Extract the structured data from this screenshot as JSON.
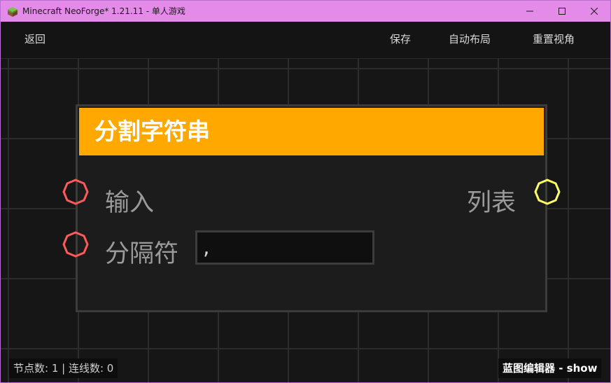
{
  "window": {
    "title": "Minecraft NeoForge* 1.21.11 - 单人游戏"
  },
  "toolbar": {
    "back_label": "返回",
    "save_label": "保存",
    "auto_layout_label": "自动布局",
    "reset_view_label": "重置视角"
  },
  "node": {
    "title": "分割字符串",
    "header_color": "#ffa800",
    "input_label": "输入",
    "output_label": "列表",
    "separator_label": "分隔符",
    "separator_value": ","
  },
  "ports": {
    "input_color": "#ff5a5a",
    "output_color": "#ffff66"
  },
  "status": {
    "stats": "节点数: 1 | 连线数: 0",
    "editor": "蓝图编辑器 - show"
  },
  "icons": {
    "app": "minecraft-grass-block-icon",
    "minimize": "minimize-icon",
    "maximize": "maximize-icon",
    "close": "close-icon"
  }
}
